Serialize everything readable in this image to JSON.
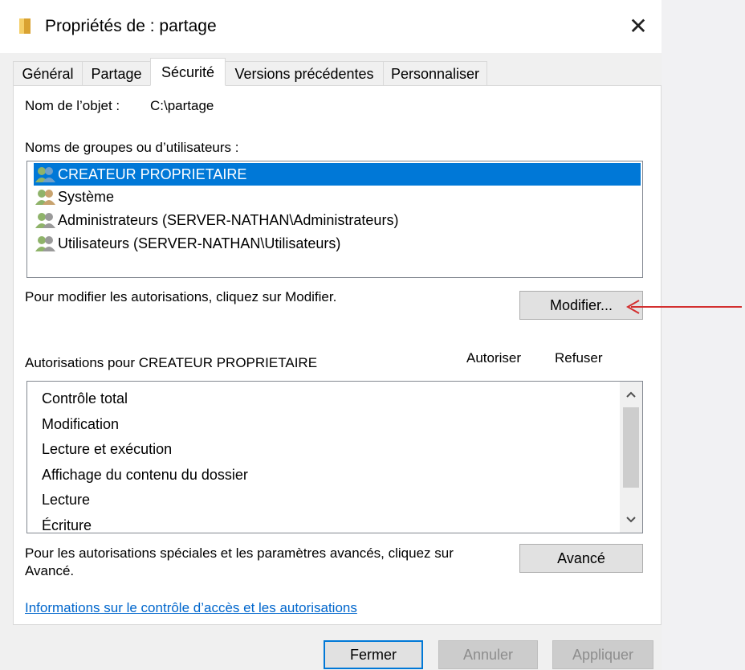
{
  "window": {
    "title": "Propriétés de : partage",
    "close_glyph": "✕"
  },
  "tabs": [
    {
      "label": "Général",
      "active": false
    },
    {
      "label": "Partage",
      "active": false
    },
    {
      "label": "Sécurité",
      "active": true
    },
    {
      "label": "Versions précédentes",
      "active": false
    },
    {
      "label": "Personnaliser",
      "active": false
    }
  ],
  "security": {
    "object_name_label": "Nom de l’objet :",
    "object_name_value": "C:\\partage",
    "groups_label": "Noms de groupes ou d’utilisateurs :",
    "groups": [
      {
        "name": "CREATEUR PROPRIETAIRE",
        "selected": true
      },
      {
        "name": "Système",
        "selected": false
      },
      {
        "name": "Administrateurs (SERVER-NATHAN\\Administrateurs)",
        "selected": false
      },
      {
        "name": "Utilisateurs (SERVER-NATHAN\\Utilisateurs)",
        "selected": false
      }
    ],
    "modify_hint": "Pour modifier les autorisations, cliquez sur Modifier.",
    "modify_button": "Modifier...",
    "permissions_for_label": "Autorisations pour CREATEUR PROPRIETAIRE",
    "allow_header": "Autoriser",
    "deny_header": "Refuser",
    "permissions": [
      "Contrôle total",
      "Modification",
      "Lecture et exécution",
      "Affichage du contenu du dossier",
      "Lecture",
      "Écriture"
    ],
    "advanced_hint_line1": "Pour les autorisations spéciales et les paramètres avancés, cliquez sur",
    "advanced_hint_line2": "Avancé.",
    "advanced_button": "Avancé",
    "help_link": "Informations sur le contrôle d’accès et les autorisations"
  },
  "footer": {
    "close_button": "Fermer",
    "cancel_button": "Annuler",
    "apply_button": "Appliquer"
  },
  "colors": {
    "selection": "#0078d7",
    "link": "#0066cc",
    "annotation_arrow": "#d32f2f"
  },
  "icons": {
    "title": "folder-icon",
    "group": "users-group-icon"
  }
}
